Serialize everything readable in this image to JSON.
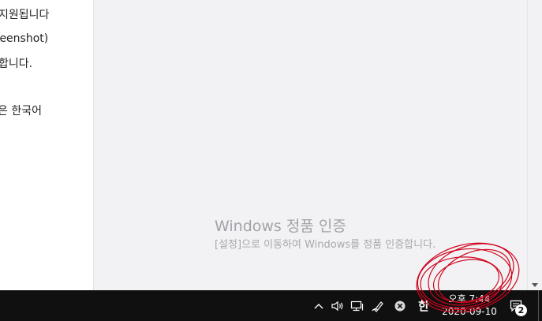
{
  "document": {
    "lines": [
      "지원됩니다",
      "reenshot)",
      "합니다.",
      "은 한국어"
    ]
  },
  "watermark": {
    "title": "Windows 정품 인증",
    "subtitle": "[설정]으로 이동하여 Windows를 정품 인증합니다."
  },
  "taskbar": {
    "tray_icons": [
      "chevron-up-icon",
      "speaker-icon",
      "network-icon",
      "pen-icon",
      "close-circle-icon"
    ],
    "ime_label": "한",
    "clock": {
      "time": "오후 7:44",
      "date": "2020-09-10"
    },
    "notification_count": "2"
  },
  "colors": {
    "taskbar": "#101010",
    "annotation": "#d0021b",
    "watermark": "#a2a2a8"
  }
}
